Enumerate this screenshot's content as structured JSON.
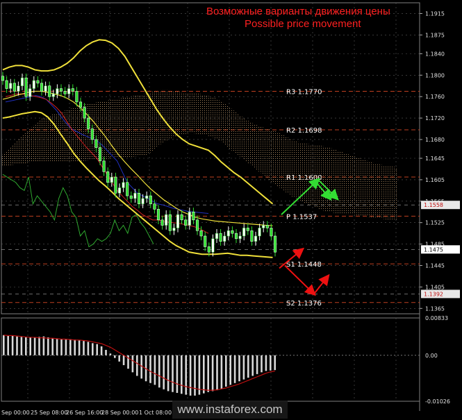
{
  "header": {
    "title_ru": "Возможные варианты движения цены",
    "title_en": "Possible price movement"
  },
  "watermark": "www.instaforex.com",
  "colors": {
    "background": "#000000",
    "grid": "#5a5a5a",
    "bollinger": "#f0e03a",
    "bull_candle": "#ffffff",
    "bear_candle": "#2fe02f",
    "chikou": "#2fa82f",
    "tenkan": "#d02020",
    "kijun": "#2030c0",
    "kumo": "#c8a070",
    "level_line": "#c04020",
    "arrow_up": "#33dd33",
    "arrow_down": "#ee1111",
    "histogram": "#d8d8d8",
    "signal": "#c01010"
  },
  "price_axis": {
    "labels": [
      "1.1915",
      "1.1875",
      "1.1840",
      "1.1800",
      "1.1760",
      "1.1720",
      "1.1680",
      "1.1645",
      "1.1605",
      "1.1565",
      "1.1525",
      "1.1485",
      "1.1445",
      "1.1405",
      "1.1365"
    ],
    "highlighted": [
      {
        "text": "1.1558",
        "bg": "#e8e8e8",
        "fg": "#c01010"
      },
      {
        "text": "1.1475",
        "bg": "#ffffff",
        "fg": "#000000"
      },
      {
        "text": "1.1392",
        "bg": "#e8e8e8",
        "fg": "#c01010"
      }
    ]
  },
  "osc_axis": {
    "labels": [
      "0.00833",
      "0.00",
      "-0.01026"
    ]
  },
  "time_axis": {
    "labels": [
      "Sep 00:00",
      "25 Sep 08:00",
      "26 Sep 16:00",
      "28 Sep 00:00",
      "1 Oct 08:00"
    ]
  },
  "levels": [
    {
      "name": "R3",
      "label": "R3  1.1770",
      "value": 1.177
    },
    {
      "name": "R2",
      "label": "R2  1.1698",
      "value": 1.1698
    },
    {
      "name": "R1",
      "label": "R1  1.1600",
      "value": 1.161
    },
    {
      "name": "P",
      "label": "P  1.1537",
      "value": 1.1537
    },
    {
      "name": "S1",
      "label": "S1  1.1448",
      "value": 1.1448
    },
    {
      "name": "S2",
      "label": "S2  1.1376",
      "value": 1.1376
    }
  ],
  "chart_data": {
    "type": "line",
    "main": {
      "ylim": [
        1.1355,
        1.1935
      ],
      "series": [
        {
          "name": "",
          "role": "price_close",
          "values": [
            1.179,
            1.1775,
            1.1785,
            1.177,
            1.178,
            1.1795,
            1.176,
            1.1775,
            1.179,
            1.1785,
            1.177,
            1.178,
            1.176,
            1.1765,
            1.1775,
            1.177,
            1.1765,
            1.1775,
            1.177,
            1.175,
            1.174,
            1.172,
            1.17,
            1.168,
            1.1665,
            1.164,
            1.162,
            1.16,
            1.161,
            1.158,
            1.159,
            1.16,
            1.1575,
            1.157,
            1.158,
            1.156,
            1.157,
            1.1575,
            1.156,
            1.155,
            1.153,
            1.152,
            1.154,
            1.151,
            1.1515,
            1.154,
            1.153,
            1.152,
            1.1545,
            1.153,
            1.151,
            1.15,
            1.148,
            1.147,
            1.1495,
            1.1505,
            1.149,
            1.15,
            1.151,
            1.1505,
            1.1495,
            1.15,
            1.1515,
            1.151,
            1.149,
            1.15,
            1.1515,
            1.152,
            1.1515,
            1.15,
            1.147
          ]
        },
        {
          "name": "",
          "role": "bollinger_upper",
          "values": [
            1.181,
            1.1815,
            1.1818,
            1.1818,
            1.1815,
            1.181,
            1.1808,
            1.1808,
            1.181,
            1.1815,
            1.1822,
            1.1832,
            1.1845,
            1.1855,
            1.1862,
            1.1866,
            1.1865,
            1.186,
            1.185,
            1.1835,
            1.1815,
            1.1795,
            1.1775,
            1.1755,
            1.1735,
            1.1718,
            1.1703,
            1.169,
            1.168,
            1.1672,
            1.1668,
            1.1664,
            1.166,
            1.165,
            1.1638,
            1.1628,
            1.1618,
            1.161,
            1.16,
            1.159,
            1.158,
            1.157,
            1.156
          ]
        },
        {
          "name": "",
          "role": "bollinger_middle",
          "values": [
            1.1755,
            1.1758,
            1.1762,
            1.1765,
            1.1768,
            1.177,
            1.177,
            1.1768,
            1.1765,
            1.1762,
            1.1757,
            1.175,
            1.174,
            1.1728,
            1.1715,
            1.17,
            1.1685,
            1.1668,
            1.1652,
            1.1638,
            1.1625,
            1.1613,
            1.16,
            1.1588,
            1.1578,
            1.1568,
            1.156,
            1.1552,
            1.1545,
            1.154,
            1.1535,
            1.1532,
            1.153,
            1.1528,
            1.1527,
            1.1526,
            1.1525,
            1.1524,
            1.1523,
            1.1522,
            1.1521,
            1.152,
            1.1519
          ]
        },
        {
          "name": "",
          "role": "bollinger_lower",
          "values": [
            1.172,
            1.1722,
            1.1725,
            1.1728,
            1.173,
            1.1732,
            1.173,
            1.1722,
            1.1708,
            1.169,
            1.1673,
            1.1655,
            1.164,
            1.1627,
            1.1615,
            1.1603,
            1.1593,
            1.1582,
            1.157,
            1.156,
            1.155,
            1.154,
            1.153,
            1.152,
            1.151,
            1.15,
            1.149,
            1.1482,
            1.1476,
            1.147,
            1.1468,
            1.1466,
            1.1466,
            1.1466,
            1.1467,
            1.1468,
            1.1466,
            1.1464,
            1.1464,
            1.1463,
            1.1462,
            1.1461,
            1.146
          ]
        },
        {
          "name": "",
          "role": "chikou_span",
          "values": [
            1.1615,
            1.161,
            1.1605,
            1.16,
            1.159,
            1.1585,
            1.161,
            1.156,
            1.1575,
            1.1565,
            1.1555,
            1.1545,
            1.153,
            1.157,
            1.159,
            1.1575,
            1.1545,
            1.1535,
            1.15,
            1.151,
            1.148,
            1.1485,
            1.1495,
            1.149,
            1.1495,
            1.1505,
            1.153,
            1.151,
            1.152,
            1.1505,
            1.1535,
            1.154,
            1.1525,
            1.1515,
            1.15,
            1.1485
          ]
        },
        {
          "name": "",
          "role": "tenkan_sen",
          "values": [
            1.176,
            1.1762,
            1.1765,
            1.1765,
            1.1764,
            1.1762,
            1.176,
            1.1758,
            1.1755,
            1.1748,
            1.174,
            1.173,
            1.1715,
            1.17,
            1.1688,
            1.1676,
            1.1665,
            1.1655,
            1.1645,
            1.163,
            1.1615,
            1.16,
            1.1585,
            1.1575,
            1.1565,
            1.1555,
            1.1548,
            1.154,
            1.1535,
            1.153,
            1.153,
            1.1528,
            1.1526,
            1.1525,
            1.1524,
            1.1522,
            1.152,
            1.1518,
            1.1515,
            1.151,
            1.1505
          ]
        },
        {
          "name": "",
          "role": "kijun_sen",
          "values": [
            1.175,
            1.1752,
            1.1754,
            1.1756,
            1.1758,
            1.176,
            1.1762,
            1.176,
            1.1755,
            1.1745,
            1.1735,
            1.1722,
            1.171,
            1.17,
            1.1695,
            1.169,
            1.1686,
            1.1682,
            1.1678,
            1.167,
            1.166,
            1.165,
            1.164,
            1.162,
            1.16,
            1.159,
            1.158,
            1.1575,
            1.157,
            1.1565,
            1.156,
            1.1558,
            1.1555,
            1.1552,
            1.155,
            1.1548,
            1.1546,
            1.1545,
            1.1544,
            1.1543,
            1.1542
          ]
        },
        {
          "name": "",
          "role": "kumo_top",
          "values": [
            1.1765,
            1.177,
            1.1772,
            1.1772,
            1.177,
            1.1768,
            1.1768,
            1.1765,
            1.1762,
            1.1758,
            1.175,
            1.174,
            1.1728,
            1.1718,
            1.171,
            1.1704,
            1.17,
            1.1695,
            1.1688,
            1.168,
            1.1675,
            1.1672,
            1.167,
            1.1668,
            1.1665,
            1.166,
            1.1655,
            1.165,
            1.1645,
            1.164,
            1.1635,
            1.1632,
            1.163,
            1.1628
          ]
        },
        {
          "name": "",
          "role": "kumo_bottom",
          "values": [
            1.165,
            1.166,
            1.1672,
            1.168,
            1.1686,
            1.169,
            1.1692,
            1.169,
            1.1688,
            1.1682,
            1.1675,
            1.1662,
            1.1652,
            1.164,
            1.163,
            1.1618,
            1.1605,
            1.1595,
            1.1585,
            1.1575,
            1.1568,
            1.156,
            1.1555,
            1.1548,
            1.1545,
            1.1542,
            1.154,
            1.154,
            1.1538,
            1.1536,
            1.1534,
            1.1532,
            1.153,
            1.1528
          ]
        }
      ]
    },
    "oscillator": {
      "ylim": [
        -0.01026,
        0.00833
      ],
      "histogram": [
        0.0045,
        0.0043,
        0.0044,
        0.0042,
        0.0041,
        0.004,
        0.004,
        0.0039,
        0.0041,
        0.0042,
        0.004,
        0.0038,
        0.0037,
        0.0036,
        0.0035,
        0.0036,
        0.0035,
        0.0033,
        0.0032,
        0.003,
        0.0027,
        0.0025,
        0.002,
        0.0012,
        0.0004,
        -0.0006,
        -0.0014,
        -0.0022,
        -0.003,
        -0.0038,
        -0.0046,
        -0.0052,
        -0.0058,
        -0.0062,
        -0.0066,
        -0.0072,
        -0.0076,
        -0.008,
        -0.0082,
        -0.0084,
        -0.0086,
        -0.0088,
        -0.009,
        -0.009,
        -0.0088,
        -0.0085,
        -0.0082,
        -0.008,
        -0.0078,
        -0.0075,
        -0.007,
        -0.0066,
        -0.0062,
        -0.0058,
        -0.0054,
        -0.005,
        -0.0046,
        -0.0042,
        -0.0038,
        -0.0035,
        -0.0034,
        -0.0033
      ],
      "signal": [
        0.0045,
        0.0044,
        0.0044,
        0.0043,
        0.0042,
        0.0041,
        0.004,
        0.004,
        0.0039,
        0.0039,
        0.0038,
        0.0038,
        0.0037,
        0.0036,
        0.0036,
        0.0035,
        0.0034,
        0.0034,
        0.0033,
        0.0032,
        0.003,
        0.0028,
        0.0026,
        0.0022,
        0.0018,
        0.0012,
        0.0006,
        0.0,
        -0.0006,
        -0.0012,
        -0.0018,
        -0.0024,
        -0.003,
        -0.0036,
        -0.0041,
        -0.0046,
        -0.0051,
        -0.0056,
        -0.006,
        -0.0064,
        -0.0067,
        -0.007,
        -0.0072,
        -0.0074,
        -0.0076,
        -0.0077,
        -0.0078,
        -0.0078,
        -0.0077,
        -0.0075,
        -0.0073,
        -0.007,
        -0.0067,
        -0.0064,
        -0.006,
        -0.0056,
        -0.0052,
        -0.0048,
        -0.0044,
        -0.004,
        -0.0037,
        -0.0035
      ]
    },
    "forecast_arrows": [
      {
        "direction": "up",
        "from": 1.154,
        "to": 1.1605
      },
      {
        "direction": "down",
        "from": 1.1475,
        "to": 1.144
      },
      {
        "direction": "up",
        "from": 1.1448,
        "to": 1.15
      },
      {
        "direction": "down",
        "from": 1.15,
        "to": 1.1395
      }
    ]
  }
}
